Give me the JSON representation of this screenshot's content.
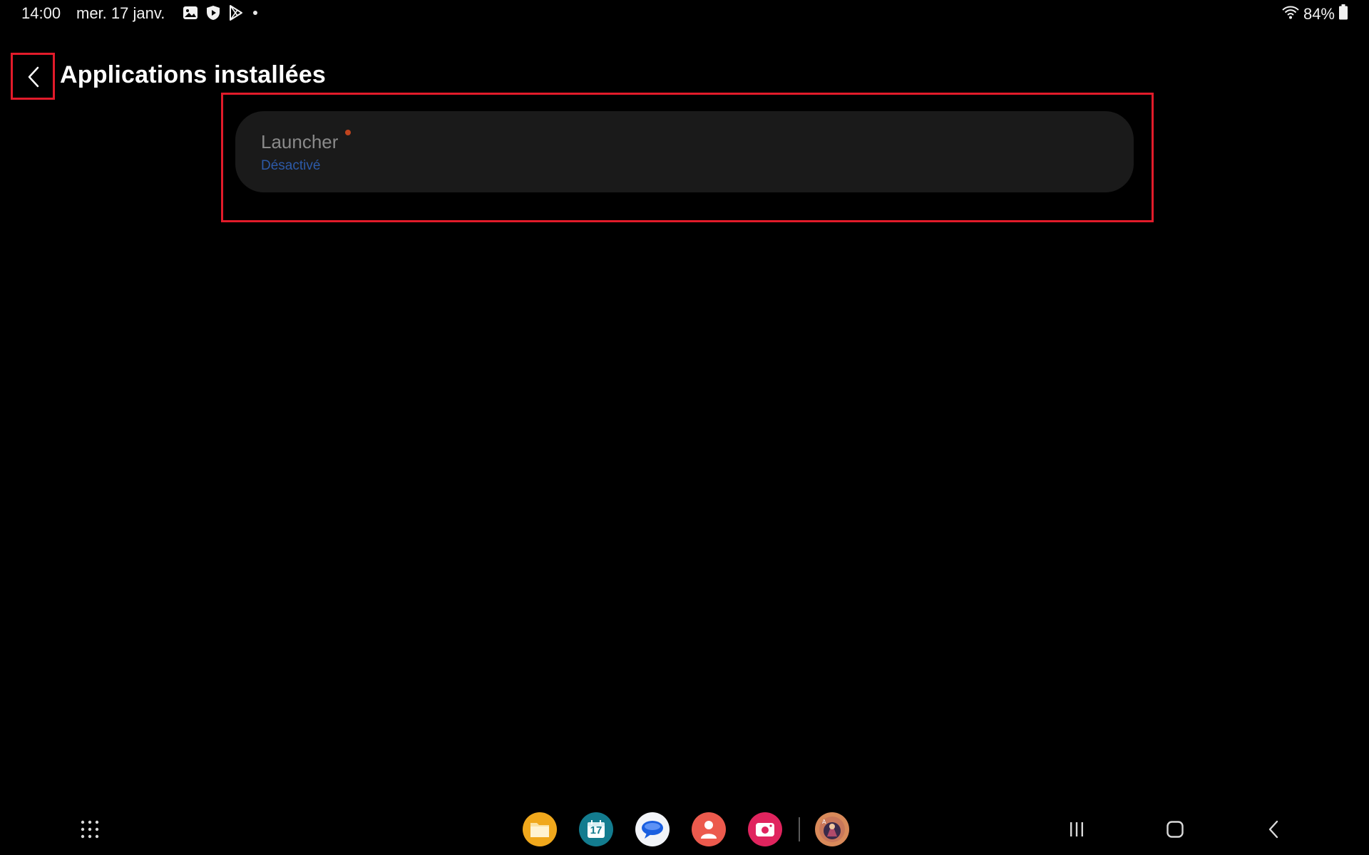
{
  "status_bar": {
    "time": "14:00",
    "date": "mer. 17 janv.",
    "battery": "84%",
    "notification_icons": [
      "gallery-icon",
      "shield-play-icon",
      "play-store-icon"
    ],
    "system_icons": [
      "wifi-icon",
      "battery-icon"
    ]
  },
  "header": {
    "title": "Applications installées",
    "back_icon": "chevron-left-icon"
  },
  "app_list": {
    "items": [
      {
        "name": "Launcher",
        "status": "Désactivé",
        "has_badge": true
      }
    ]
  },
  "taskbar": {
    "apps_button_icon": "apps-grid-icon",
    "dock_apps": [
      {
        "icon": "my-files-icon",
        "color": "#f0a81c"
      },
      {
        "icon": "calendar-icon",
        "color": "#137c8f",
        "label": "17"
      },
      {
        "icon": "messages-icon",
        "color": "#f2f4f8"
      },
      {
        "icon": "contacts-icon",
        "color": "#ec5a4d"
      },
      {
        "icon": "screen-recorder-icon",
        "color": "#e0245e"
      },
      {
        "icon": "game-app-icon",
        "color": "#d98a5a"
      }
    ],
    "nav": [
      "recents-icon",
      "home-icon",
      "back-icon"
    ]
  },
  "colors": {
    "highlight": "#e21b2a",
    "card": "#1a1a1a",
    "status_text": "#2d5aa8",
    "badge": "#c0441e"
  }
}
